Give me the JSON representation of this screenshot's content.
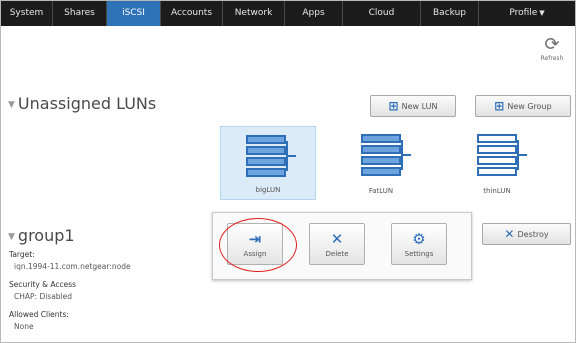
{
  "nav": {
    "items": [
      {
        "label": "System"
      },
      {
        "label": "Shares"
      },
      {
        "label": "iSCSI",
        "active": true
      },
      {
        "label": "Accounts"
      },
      {
        "label": "Network"
      },
      {
        "label": "Apps"
      },
      {
        "label": "Cloud"
      },
      {
        "label": "Backup"
      },
      {
        "label": "Profile"
      }
    ]
  },
  "refresh": {
    "label": "Refresh",
    "icon": "refresh-icon"
  },
  "unassigned": {
    "title": "Unassigned LUNs",
    "new_lun_label": "New LUN",
    "new_group_label": "New Group",
    "luns": [
      {
        "label": "bigLUN",
        "style": "filled",
        "selected": true
      },
      {
        "label": "FatLUN",
        "style": "filled"
      },
      {
        "label": "thinLUN",
        "style": "outline"
      }
    ]
  },
  "group": {
    "title": "group1",
    "destroy_label": "Destroy",
    "target_label": "Target:",
    "target_value": "iqn.1994-11.com.netgear:node",
    "security_label": "Security & Access",
    "security_value": "CHAP: Disabled",
    "clients_label": "Allowed Clients:",
    "clients_value": "None"
  },
  "popup": {
    "assign_label": "Assign",
    "delete_label": "Delete",
    "settings_label": "Settings"
  },
  "colors": {
    "accent": "#2f6fb8",
    "nav_bg": "#1c1c1c",
    "active_tab": "#2e73b8",
    "highlight_circle": "#e02020"
  }
}
